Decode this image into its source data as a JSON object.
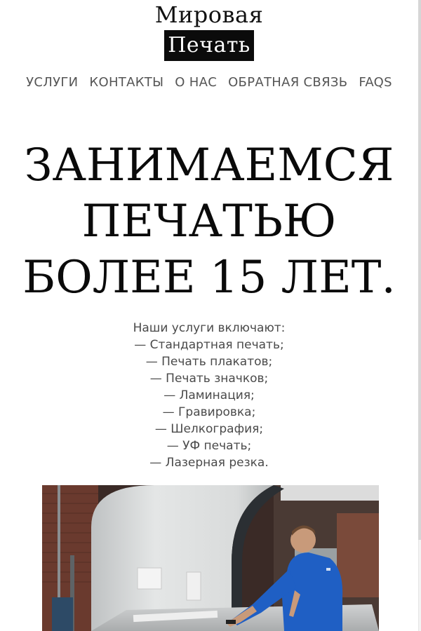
{
  "logo": {
    "line1": "Мировая",
    "line2": "Печать"
  },
  "nav": {
    "items": [
      {
        "label": "УСЛУГИ"
      },
      {
        "label": "КОНТАКТЫ"
      },
      {
        "label": "О НАС"
      },
      {
        "label": "ОБРАТНАЯ СВЯЗЬ"
      },
      {
        "label": "FAQS"
      }
    ]
  },
  "hero": {
    "lines": [
      "ЗАНИМАЕМСЯ",
      "ПЕЧАТЬЮ",
      "БОЛЕЕ 15 ЛЕТ."
    ]
  },
  "services": {
    "intro": "Наши услуги включают:",
    "items": [
      "— Стандартная печать;",
      "— Печать плакатов;",
      "— Печать значков;",
      "— Ламинация;",
      "— Гравировка;",
      "— Шелкография;",
      "— УФ печать;",
      "— Лазерная резка."
    ]
  },
  "colors": {
    "text": "#111111",
    "nav_text": "#555555",
    "logo_bg": "#0b0b0b",
    "shirt_blue": "#1f5fc4"
  }
}
